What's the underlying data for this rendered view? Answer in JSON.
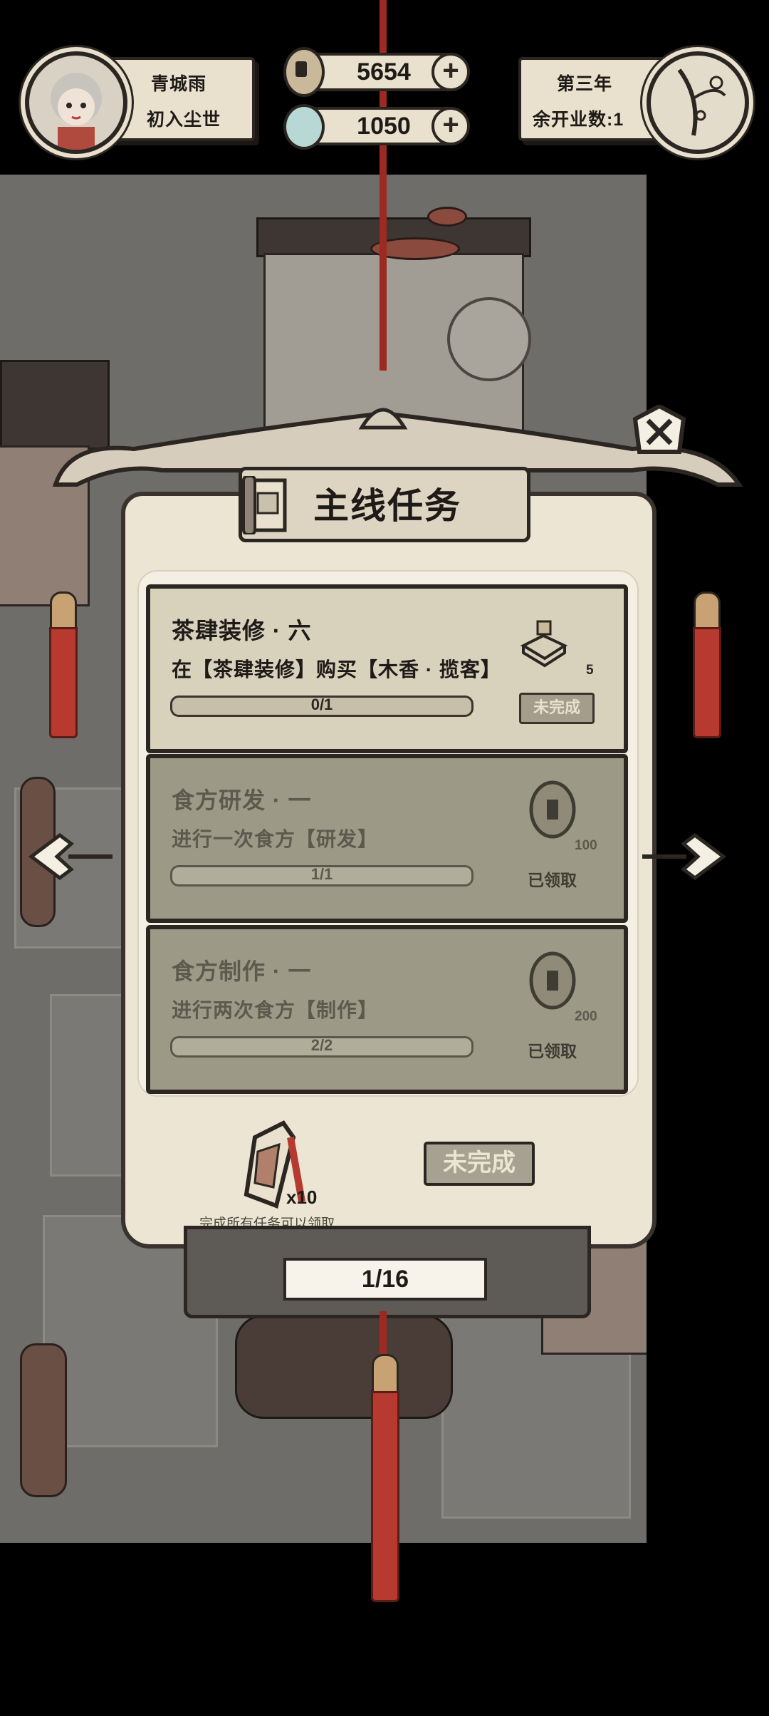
{
  "player": {
    "name": "青城雨",
    "title": "初入尘世"
  },
  "currency": {
    "coins": "5654",
    "jade": "1050"
  },
  "calendar": {
    "year": "第三年",
    "remaining_openings": "余开业数:1"
  },
  "quest_board": {
    "title": "主线任务",
    "tasks": [
      {
        "title": "茶肆装修 · 六",
        "description": "在【茶肆装修】购买【木香 · 揽客】",
        "progress_text": "0/1",
        "progress": 0.0,
        "reward_icon": "book-icon",
        "reward_count": "5",
        "status": "未完成"
      },
      {
        "title": "食方研发 · 一",
        "description": "进行一次食方【研发】",
        "progress_text": "1/1",
        "progress": 1.0,
        "reward_icon": "coin-icon",
        "reward_count": "100",
        "status": "已领取"
      },
      {
        "title": "食方制作 · 一",
        "description": "进行两次食方【制作】",
        "progress_text": "2/2",
        "progress": 1.0,
        "reward_icon": "coin-icon",
        "reward_count": "200",
        "status": "已领取"
      }
    ],
    "final_reward": {
      "icon": "jade-pendant-icon",
      "quantity": "x10",
      "hint": "完成所有任务可以领取",
      "button_label": "未完成"
    },
    "page_indicator": "1/16"
  },
  "colors": {
    "tassel_red": "#b63a2f",
    "paper": "#ece5d3",
    "ink": "#2b2622"
  }
}
